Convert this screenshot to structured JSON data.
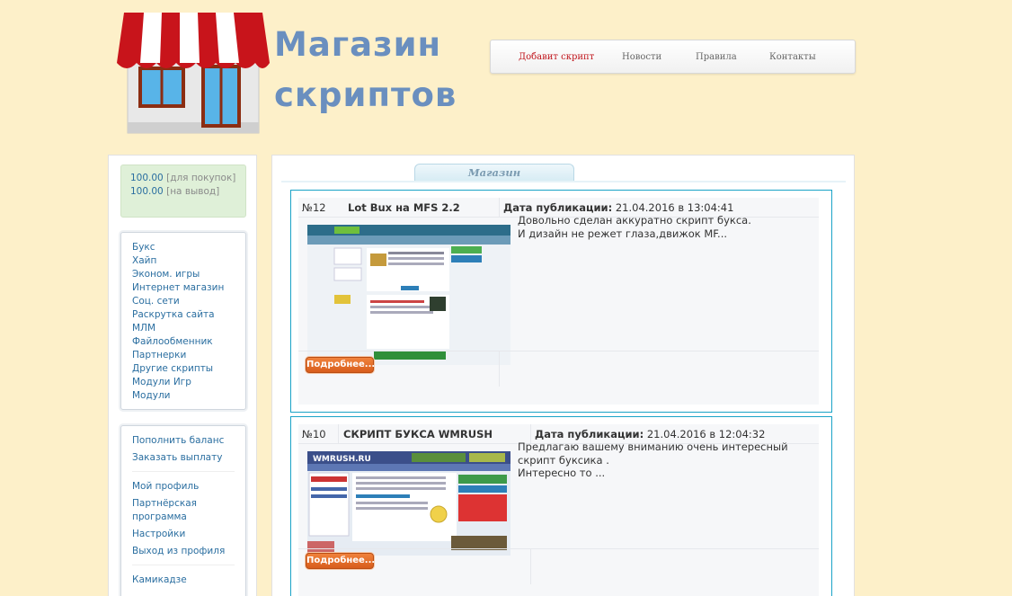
{
  "logo": {
    "line1": "Магазин",
    "line2": "скриптов"
  },
  "topnav": [
    {
      "label": "Добавит скрипт",
      "active": true
    },
    {
      "label": "Новости"
    },
    {
      "label": "Правила"
    },
    {
      "label": "Контакты"
    }
  ],
  "balance": {
    "buy_value": "100.00",
    "buy_label": "[для покупок]",
    "withdraw_value": "100.00",
    "withdraw_label": "[на вывод]"
  },
  "categories": [
    "Букс",
    "Хайп",
    "Эконом. игры",
    "Интернет магазин",
    "Соц. сети",
    "Раскрутка сайта",
    "МЛМ",
    "Файлообменник",
    "Партнерки",
    "Другие скрипты",
    "Модули Игр",
    "Модули"
  ],
  "account": {
    "top_up": "Пополнить баланс",
    "withdraw": "Заказать выплату",
    "profile": "Мой профиль",
    "partner": "Партнёрская программа",
    "settings": "Настройки",
    "logout": "Выход из профиля",
    "username": "Камикадзе"
  },
  "tab_label": "Магазин",
  "items": [
    {
      "id": "№12",
      "title": "Lot Bux на MFS 2.2",
      "date_label": "Дата публикации:",
      "date": "21.04.2016 в 13:04:41",
      "desc_line1": "Довольно сделан аккуратно скрипт букса.",
      "desc_line2": "И дизайн не режет глаза,движок MF...",
      "more": "Подробнее..."
    },
    {
      "id": "№10",
      "title": "СКРИПТ БУКСА WMRUSH",
      "date_label": "Дата публикации:",
      "date": "21.04.2016 в 12:04:32",
      "desc_line1": "Предлагаю вашему вниманию очень интересный скрипт буксика .",
      "desc_line2": "Интересно то ...",
      "more": "Подробнее...",
      "shot_brand": "WMRUSH.RU"
    }
  ],
  "colors": {
    "background": "#fdf0c9",
    "link": "#2a6ea0",
    "card_border": "#1aa3c7",
    "active_nav": "#c0141b",
    "button": "#e06a28"
  }
}
